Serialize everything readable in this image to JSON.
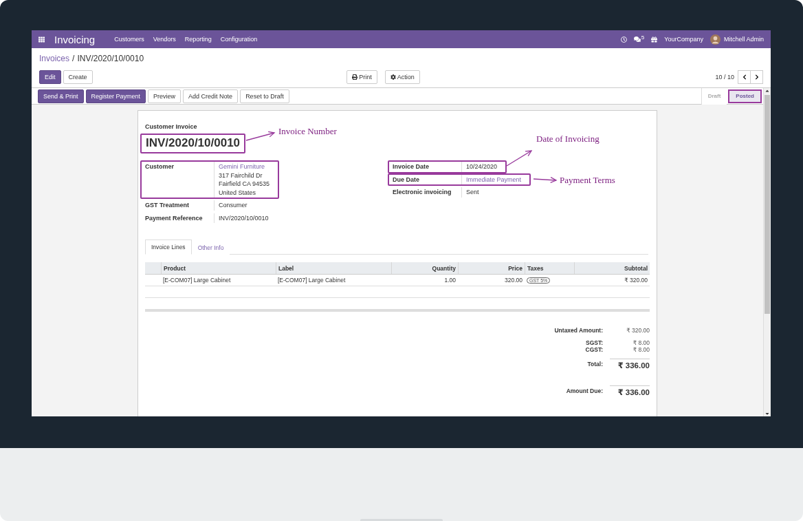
{
  "navbar": {
    "app": "Invoicing",
    "menu": [
      "Customers",
      "Vendors",
      "Reporting",
      "Configuration"
    ],
    "chat_count": "5",
    "company": "YourCompany",
    "user": "Mitchell Admin"
  },
  "breadcrumb": {
    "parent": "Invoices",
    "separator": "/",
    "current": "INV/2020/10/0010"
  },
  "buttons": [
    {
      "label": "Edit",
      "primary": true
    },
    {
      "label": "Create",
      "primary": false
    }
  ],
  "center_buttons": [
    {
      "label": "Print"
    },
    {
      "label": "Action"
    }
  ],
  "pager": "10 / 10",
  "actions": [
    {
      "label": "Send & Print",
      "primary": true
    },
    {
      "label": "Register Payment",
      "primary": true
    },
    {
      "label": "Preview",
      "primary": false
    },
    {
      "label": "Add Credit Note",
      "primary": false
    },
    {
      "label": "Reset to Draft",
      "primary": false
    }
  ],
  "statuses": [
    {
      "label": "Draft",
      "selected": false,
      "highlighted": false
    },
    {
      "label": "Posted",
      "selected": true,
      "highlighted": true
    }
  ],
  "sheet": {
    "type_label": "Customer Invoice",
    "number": "INV/2020/10/0010",
    "number_highlighted": true,
    "left_fields": [
      {
        "label": "Customer",
        "lines": [
          "Gemini Furniture",
          "317 Fairchild Dr",
          "Fairfield CA 94535",
          "United States"
        ],
        "link": true,
        "highlighted": true
      },
      {
        "label": "GST Treatment",
        "lines": [
          "Consumer"
        ],
        "link": false,
        "highlighted": false
      },
      {
        "label": "Payment Reference",
        "lines": [
          "INV/2020/10/0010"
        ],
        "link": false,
        "highlighted": false
      }
    ],
    "right_fields": [
      {
        "label": "Invoice Date",
        "lines": [
          "10/24/2020"
        ],
        "link": false,
        "highlighted": true
      },
      {
        "label": "Due Date",
        "lines": [
          "Immediate Payment"
        ],
        "link": true,
        "highlighted": true
      },
      {
        "label": "Electronic invoicing",
        "lines": [
          "Sent"
        ],
        "link": false,
        "highlighted": false
      }
    ],
    "tabs": [
      {
        "label": "Invoice Lines",
        "selected": true
      },
      {
        "label": "Other Info",
        "selected": false
      }
    ],
    "table": {
      "columns": [
        {
          "label": "Product"
        },
        {
          "label": "Label"
        },
        {
          "label": "Quantity"
        },
        {
          "label": "Price"
        },
        {
          "label": "Taxes"
        },
        {
          "label": "Subtotal"
        }
      ],
      "rows": [
        {
          "product": "[E-COM07] Large Cabinet",
          "label": "[E-COM07] Large Cabinet",
          "quantity": "1.00",
          "price": "320.00",
          "taxes": [
            "GST 5%"
          ],
          "subtotal": "₹ 320.00"
        }
      ]
    },
    "totals": [
      {
        "label": "Untaxed Amount:",
        "value": "₹ 320.00",
        "kind": "plain"
      },
      {
        "label": "SGST:",
        "value": "₹ 8.00",
        "kind": "tax"
      },
      {
        "label": "CGST:",
        "value": "₹ 8.00",
        "kind": "tax"
      },
      {
        "label": "Total:",
        "value": "₹ 336.00",
        "kind": "grand"
      },
      {
        "label": "Amount Due:",
        "value": "₹ 336.00",
        "kind": "due"
      }
    ]
  },
  "annotations": [
    {
      "text": "Invoice Number"
    },
    {
      "text": "Date of Invoicing"
    },
    {
      "text": "Payment Terms"
    }
  ]
}
